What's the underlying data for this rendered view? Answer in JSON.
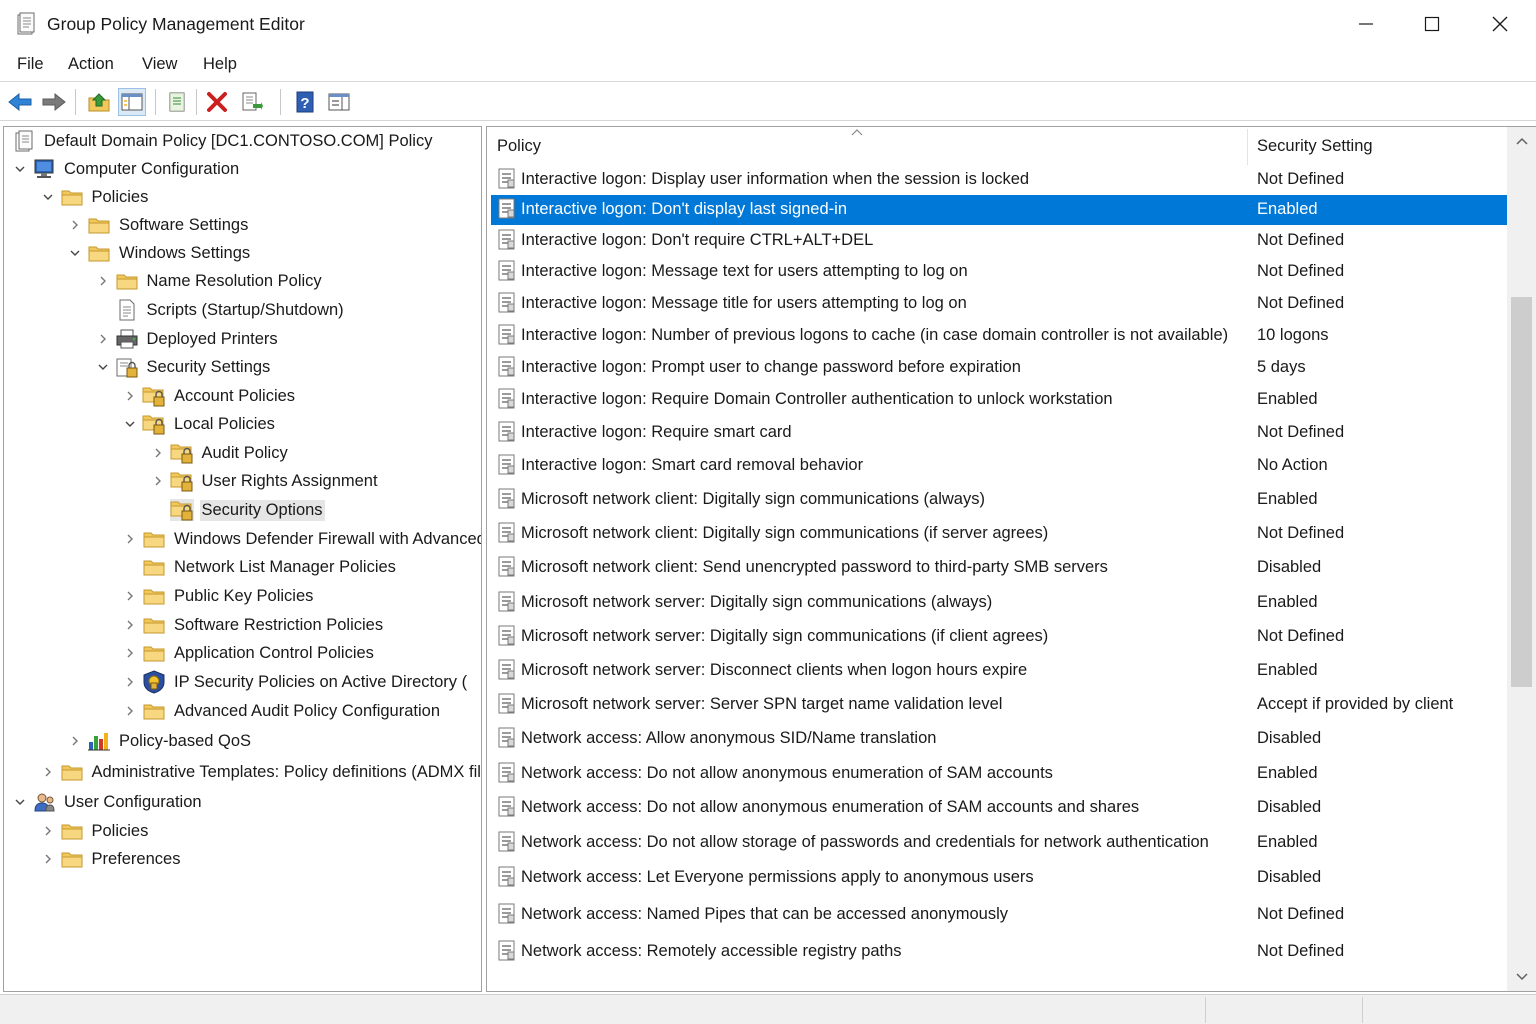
{
  "window": {
    "title": "Group Policy Management Editor"
  },
  "menu": [
    {
      "label": "File",
      "name": "menu-file"
    },
    {
      "label": "Action",
      "name": "menu-action"
    },
    {
      "label": "View",
      "name": "menu-view"
    },
    {
      "label": "Help",
      "name": "menu-help"
    }
  ],
  "tree": [
    {
      "label": "Default Domain Policy [DC1.CONTOSO.COM] Policy",
      "level": 0,
      "chev": "none",
      "icon": "policy-document-icon",
      "name": "tree-root"
    },
    {
      "label": "Computer Configuration",
      "level": 0,
      "chev": "down",
      "icon": "computer-icon",
      "name": "tree-computer-configuration"
    },
    {
      "label": "Policies",
      "level": 1,
      "chev": "down",
      "icon": "folder-icon",
      "name": "tree-policies"
    },
    {
      "label": "Software Settings",
      "level": 2,
      "chev": "right",
      "icon": "folder-icon",
      "name": "tree-software-settings"
    },
    {
      "label": "Windows Settings",
      "level": 2,
      "chev": "down",
      "icon": "folder-icon",
      "name": "tree-windows-settings"
    },
    {
      "label": "Name Resolution Policy",
      "level": 3,
      "chev": "right",
      "icon": "folder-icon",
      "name": "tree-name-resolution-policy"
    },
    {
      "label": "Scripts (Startup/Shutdown)",
      "level": 3,
      "chev": "none",
      "icon": "script-icon",
      "name": "tree-scripts"
    },
    {
      "label": "Deployed Printers",
      "level": 3,
      "chev": "right",
      "icon": "printer-icon",
      "name": "tree-deployed-printers"
    },
    {
      "label": "Security Settings",
      "level": 3,
      "chev": "down",
      "icon": "security-settings-icon",
      "name": "tree-security-settings"
    },
    {
      "label": "Account Policies",
      "level": 4,
      "chev": "right",
      "icon": "locked-folder-icon",
      "name": "tree-account-policies"
    },
    {
      "label": "Local Policies",
      "level": 4,
      "chev": "down",
      "icon": "locked-folder-icon",
      "name": "tree-local-policies"
    },
    {
      "label": "Audit Policy",
      "level": 5,
      "chev": "right",
      "icon": "locked-folder-icon",
      "name": "tree-audit-policy"
    },
    {
      "label": "User Rights Assignment",
      "level": 5,
      "chev": "right",
      "icon": "locked-folder-icon",
      "name": "tree-user-rights-assignment"
    },
    {
      "label": "Security Options",
      "level": 5,
      "chev": "none",
      "icon": "locked-folder-icon",
      "name": "tree-security-options",
      "selected": true
    },
    {
      "label": "Windows Defender Firewall with Advanced Security",
      "level": 4,
      "chev": "right",
      "icon": "folder-icon",
      "name": "tree-windows-defender-firewall"
    },
    {
      "label": "Network List Manager Policies",
      "level": 4,
      "chev": "none",
      "icon": "folder-icon",
      "name": "tree-network-list-manager"
    },
    {
      "label": "Public Key Policies",
      "level": 4,
      "chev": "right",
      "icon": "folder-icon",
      "name": "tree-public-key-policies"
    },
    {
      "label": "Software Restriction Policies",
      "level": 4,
      "chev": "right",
      "icon": "folder-icon",
      "name": "tree-software-restriction-policies"
    },
    {
      "label": "Application Control Policies",
      "level": 4,
      "chev": "right",
      "icon": "folder-icon",
      "name": "tree-application-control-policies"
    },
    {
      "label": "IP Security Policies on Active Directory (",
      "level": 4,
      "chev": "right",
      "icon": "ip-security-icon",
      "name": "tree-ip-security-policies"
    },
    {
      "label": "Advanced Audit Policy Configuration",
      "level": 4,
      "chev": "right",
      "icon": "folder-icon",
      "name": "tree-advanced-audit-policy"
    },
    {
      "label": "Policy-based QoS",
      "level": 2,
      "chev": "right",
      "icon": "qos-chart-icon",
      "name": "tree-policy-based-qos"
    },
    {
      "label": "Administrative Templates: Policy definitions (ADMX files)",
      "level": 1,
      "chev": "right",
      "icon": "folder-icon",
      "name": "tree-administrative-templates"
    },
    {
      "label": "User Configuration",
      "level": 0,
      "chev": "down",
      "icon": "user-icon",
      "name": "tree-user-configuration"
    },
    {
      "label": "Policies",
      "level": 1,
      "chev": "right",
      "icon": "folder-icon",
      "name": "tree-user-policies"
    },
    {
      "label": "Preferences",
      "level": 1,
      "chev": "right",
      "icon": "folder-icon",
      "name": "tree-user-preferences"
    }
  ],
  "list": {
    "col_policy": "Policy",
    "col_setting": "Security Setting",
    "rows": [
      {
        "policy": "Interactive logon: Display user information when the session is locked",
        "setting": "Not Defined"
      },
      {
        "policy": "Interactive logon: Don't display last signed-in",
        "setting": "Enabled",
        "selected": true
      },
      {
        "policy": "Interactive logon: Don't require CTRL+ALT+DEL",
        "setting": "Not Defined"
      },
      {
        "policy": "Interactive logon: Message text for users attempting to log on",
        "setting": "Not Defined"
      },
      {
        "policy": "Interactive logon: Message title for users attempting to log on",
        "setting": "Not Defined"
      },
      {
        "policy": "Interactive logon: Number of previous logons to cache (in case domain controller is not available)",
        "setting": "10 logons"
      },
      {
        "policy": "Interactive logon: Prompt user to change password before expiration",
        "setting": "5 days"
      },
      {
        "policy": "Interactive logon: Require Domain Controller authentication to unlock workstation",
        "setting": "Enabled"
      },
      {
        "policy": "Interactive logon: Require smart card",
        "setting": "Not Defined"
      },
      {
        "policy": "Interactive logon: Smart card removal behavior",
        "setting": "No Action"
      },
      {
        "policy": "Microsoft network client: Digitally sign communications (always)",
        "setting": "Enabled"
      },
      {
        "policy": "Microsoft network client: Digitally sign communications (if server agrees)",
        "setting": "Not Defined"
      },
      {
        "policy": "Microsoft network client: Send unencrypted password to third-party SMB servers",
        "setting": "Disabled"
      },
      {
        "policy": "Microsoft network server: Digitally sign communications (always)",
        "setting": "Enabled"
      },
      {
        "policy": "Microsoft network server: Digitally sign communications (if client agrees)",
        "setting": "Not Defined"
      },
      {
        "policy": "Microsoft network server: Disconnect clients when logon hours expire",
        "setting": "Enabled"
      },
      {
        "policy": "Microsoft network server: Server SPN target name validation level",
        "setting": "Accept if provided by client"
      },
      {
        "policy": "Network access: Allow anonymous SID/Name translation",
        "setting": "Disabled"
      },
      {
        "policy": "Network access: Do not allow anonymous enumeration of SAM accounts",
        "setting": "Enabled"
      },
      {
        "policy": "Network access: Do not allow anonymous enumeration of SAM accounts and shares",
        "setting": "Disabled"
      },
      {
        "policy": "Network access: Do not allow storage of passwords and credentials for network authentication",
        "setting": "Enabled"
      },
      {
        "policy": "Network access: Let Everyone permissions apply to anonymous users",
        "setting": "Disabled"
      },
      {
        "policy": "Network access: Named Pipes that can be accessed anonymously",
        "setting": "Not Defined"
      },
      {
        "policy": "Network access: Remotely accessible registry paths",
        "setting": "Not Defined"
      }
    ]
  },
  "colors": {
    "selection": "#0078d7",
    "folder": "#f2c75c",
    "pane_border": "#a0a0a0"
  }
}
